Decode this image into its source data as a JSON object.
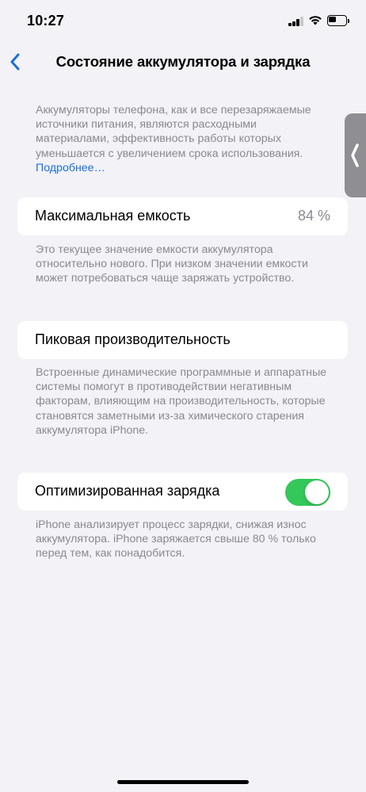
{
  "status_bar": {
    "time": "10:27",
    "signal_bars_active": 3,
    "battery_level": 0.45
  },
  "nav": {
    "title": "Состояние аккумулятора и зарядка",
    "back_icon": "chevron-left-icon"
  },
  "intro": {
    "text": "Аккумуляторы телефона, как и все перезаряжаемые источники питания, являются расходными материалами, эффективность работы которых уменьшается с увеличением срока использования.",
    "link": "Подробнее…"
  },
  "max_capacity": {
    "label": "Максимальная емкость",
    "value": "84 %",
    "description": "Это текущее значение емкости аккумулятора относительно нового. При низком значении емкости может потребоваться чаще заряжать устройство."
  },
  "peak_performance": {
    "label": "Пиковая производительность",
    "description": "Встроенные динамические программные и аппаратные системы помогут в противодействии негативным факторам, влияющим на производительность, которые становятся заметными из-за химического старения аккумулятора iPhone."
  },
  "optimized_charging": {
    "label": "Оптимизированная зарядка",
    "enabled": true,
    "description": "iPhone анализирует процесс зарядки, снижая износ аккумулятора. iPhone заряжается свыше 80 % только перед тем, как понадобится."
  },
  "colors": {
    "accent": "#1b6fd8",
    "toggle_on": "#34c759",
    "background": "#f2f2f7"
  }
}
